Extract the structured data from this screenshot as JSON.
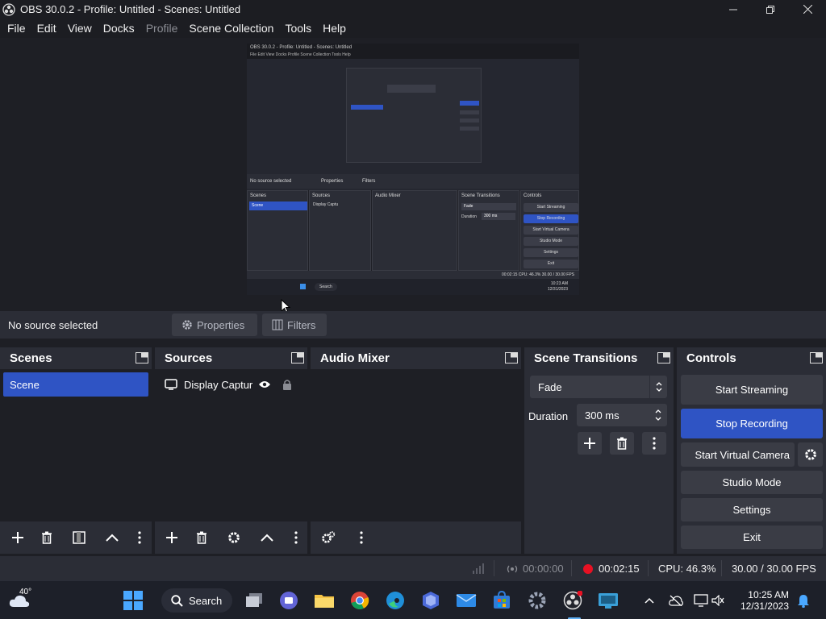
{
  "window": {
    "title": "OBS 30.0.2 - Profile: Untitled - Scenes: Untitled"
  },
  "menu": [
    "File",
    "Edit",
    "View",
    "Docks",
    "Profile",
    "Scene Collection",
    "Tools",
    "Help"
  ],
  "preview": {
    "title": "OBS 30.0.2 - Profile: Untitled - Scenes: Untitled",
    "menu": "File  Edit  View  Docks  Profile  Scene Collection  Tools  Help",
    "no_source": "No source selected",
    "properties": "Properties",
    "filters": "Filters",
    "scenes": "Scenes",
    "scene": "Scene",
    "sources": "Sources",
    "display_capture": "Display Captu",
    "audio_mixer": "Audio Mixer",
    "scene_transitions": "Scene Transitions",
    "fade": "Fade",
    "duration": "Duration",
    "duration_value": "300 ms",
    "controls": "Controls",
    "buttons": [
      "Start Streaming",
      "Stop Recording",
      "Start Virtual Camera",
      "Studio Mode",
      "Settings",
      "Exit"
    ],
    "status": "00:02:15   CPU: 46.3%   30.00 / 30.00 FPS",
    "search": "Search",
    "clock_time": "10:23 AM",
    "clock_date": "12/31/2023"
  },
  "source_bar": {
    "no_source": "No source selected",
    "properties": "Properties",
    "filters": "Filters"
  },
  "docks": {
    "scenes": {
      "title": "Scenes",
      "items": [
        "Scene"
      ]
    },
    "sources": {
      "title": "Sources",
      "items": [
        "Display Captur"
      ]
    },
    "audio_mixer": {
      "title": "Audio Mixer"
    },
    "transitions": {
      "title": "Scene Transitions",
      "selected": "Fade",
      "duration_label": "Duration",
      "duration_value": "300 ms"
    },
    "controls": {
      "title": "Controls",
      "start_streaming": "Start Streaming",
      "stop_recording": "Stop Recording",
      "start_virtual_camera": "Start Virtual Camera",
      "studio_mode": "Studio Mode",
      "settings": "Settings",
      "exit": "Exit"
    }
  },
  "status": {
    "stream_time": "00:00:00",
    "rec_time": "00:02:15",
    "cpu": "CPU: 46.3%",
    "fps": "30.00 / 30.00 FPS"
  },
  "taskbar": {
    "weather": "40°",
    "search": "Search",
    "time": "10:25 AM",
    "date": "12/31/2023"
  },
  "colors": {
    "accent": "#2f54c4",
    "panel": "#2b2d36",
    "background": "#1e1f25",
    "record_red": "#e81123"
  }
}
